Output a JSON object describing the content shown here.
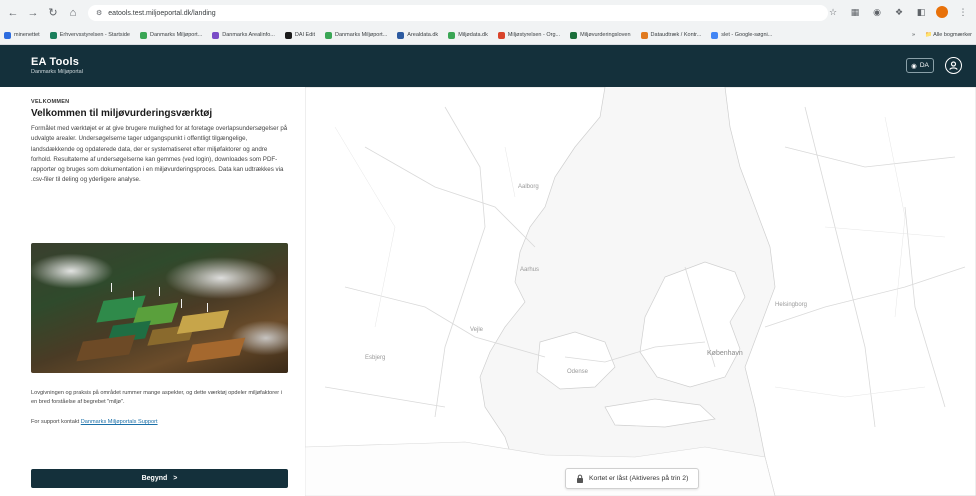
{
  "browser": {
    "url": "eatools.test.miljoeportal.dk/landing",
    "bookmarks": [
      {
        "label": "minenettet",
        "color": "#2d6cdf"
      },
      {
        "label": "Erhvervsstyrelsen - Startside",
        "color": "#1b7f5c"
      },
      {
        "label": "Danmarks Miljøport...",
        "color": "#3aa655"
      },
      {
        "label": "Danmarks Arealinfo...",
        "color": "#7a4cc7"
      },
      {
        "label": "DAI Edit",
        "color": "#1a1a1a"
      },
      {
        "label": "Danmarks Miljøport...",
        "color": "#3aa655"
      },
      {
        "label": "Arealdata.dk",
        "color": "#2c5aa0"
      },
      {
        "label": "Miljødata.dk",
        "color": "#3aa655"
      },
      {
        "label": "Miljøstyrelsen - Org...",
        "color": "#d9442b"
      },
      {
        "label": "Miljøvurderingsloven",
        "color": "#1b6e3a"
      },
      {
        "label": "Dataudtræk / Kontr...",
        "color": "#e07a1f"
      },
      {
        "label": "slet - Google-søgni...",
        "color": "#4285f4"
      }
    ],
    "bookmarks_more": "»",
    "all_bookmarks": "Alle bogmærker"
  },
  "app": {
    "title": "EA Tools",
    "subtitle": "Danmarks Miljøportal",
    "lang_label": "DA"
  },
  "panel": {
    "kicker": "VELKOMMEN",
    "title": "Velkommen til miljøvurderingsværktøj",
    "intro": "Formålet med værktøjet er at give brugere mulighed for at foretage overlapsundersøgelser på udvalgte arealer. Undersøgelserne tager udgangspunkt i offentligt tilgængelige, landsdækkende og opdaterede data, der er systematiseret efter miljøfaktorer og andre forhold. Resultaterne af undersøgelserne kan gemmes (ved login), downloades som PDF-rapporter og bruges som dokumentation i en miljøvurderingsproces. Data kan udtrækkes via .csv-filer til deling og yderligere analyse.",
    "legal": "Lovgivningen og praksis på området rummer mange aspekter, og dette værktøj opdeler miljøfaktorer i en bred forståelse af begrebet \"miljø\".",
    "support_prefix": "For support kontakt",
    "support_link": "Danmarks Miljøportals Support",
    "begin_label": "Begynd",
    "begin_arrow": ">"
  },
  "map": {
    "lock_text": "Kortet er låst (Aktiveres på trin 2)",
    "places": [
      "Aalborg",
      "Aarhus",
      "Vejle",
      "Odense",
      "København",
      "Esbjerg",
      "Helsingborg"
    ]
  }
}
